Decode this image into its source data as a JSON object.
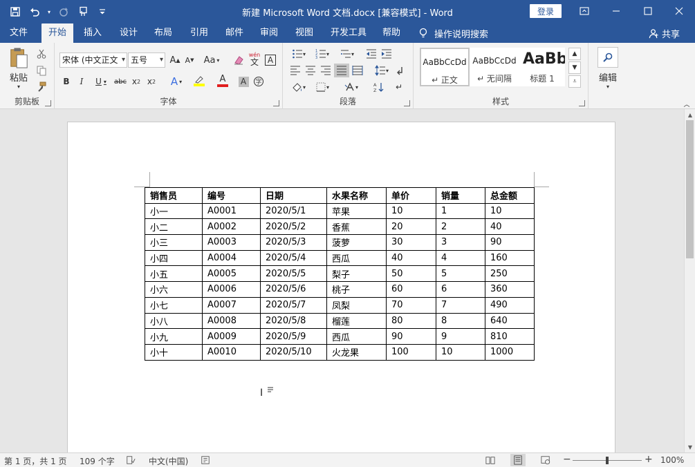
{
  "titlebar": {
    "title": "新建 Microsoft Word 文档.docx [兼容模式]  -  Word",
    "login": "登录"
  },
  "tabs": [
    {
      "label": "文件",
      "name": "tab-file"
    },
    {
      "label": "开始",
      "name": "tab-home"
    },
    {
      "label": "插入",
      "name": "tab-insert"
    },
    {
      "label": "设计",
      "name": "tab-design"
    },
    {
      "label": "布局",
      "name": "tab-layout"
    },
    {
      "label": "引用",
      "name": "tab-references"
    },
    {
      "label": "邮件",
      "name": "tab-mailings"
    },
    {
      "label": "审阅",
      "name": "tab-review"
    },
    {
      "label": "视图",
      "name": "tab-view"
    },
    {
      "label": "开发工具",
      "name": "tab-developer"
    },
    {
      "label": "帮助",
      "name": "tab-help"
    }
  ],
  "tell_me": "操作说明搜索",
  "share": "共享",
  "ribbon": {
    "clipboard": {
      "label": "剪贴板",
      "paste": "粘贴"
    },
    "font": {
      "label": "字体",
      "font_name": "宋体 (中文正文",
      "font_size": "五号",
      "change_case": "Aa",
      "phonetic": "wén",
      "phonetic_char": "文"
    },
    "paragraph": {
      "label": "段落"
    },
    "styles": {
      "label": "样式",
      "items": [
        {
          "sample": "AaBbCcDd",
          "name": "↵ 正文"
        },
        {
          "sample": "AaBbCcDd",
          "name": "↵ 无间隔"
        },
        {
          "sample": "AaBb",
          "name": "标题 1"
        }
      ]
    },
    "editing": {
      "label": "编辑"
    }
  },
  "table": {
    "headers": [
      "销售员",
      "编号",
      "日期",
      "水果名称",
      "单价",
      "销量",
      "总金额"
    ],
    "rows": [
      [
        "小一",
        "A0001",
        "2020/5/1",
        "苹果",
        "10",
        "1",
        "10"
      ],
      [
        "小二",
        "A0002",
        "2020/5/2",
        "香蕉",
        "20",
        "2",
        "40"
      ],
      [
        "小三",
        "A0003",
        "2020/5/3",
        "菠萝",
        "30",
        "3",
        "90"
      ],
      [
        "小四",
        "A0004",
        "2020/5/4",
        "西瓜",
        "40",
        "4",
        "160"
      ],
      [
        "小五",
        "A0005",
        "2020/5/5",
        "梨子",
        "50",
        "5",
        "250"
      ],
      [
        "小六",
        "A0006",
        "2020/5/6",
        "桃子",
        "60",
        "6",
        "360"
      ],
      [
        "小七",
        "A0007",
        "2020/5/7",
        "凤梨",
        "70",
        "7",
        "490"
      ],
      [
        "小八",
        "A0008",
        "2020/5/8",
        "榴莲",
        "80",
        "8",
        "640"
      ],
      [
        "小九",
        "A0009",
        "2020/5/9",
        "西瓜",
        "90",
        "9",
        "810"
      ],
      [
        "小十",
        "A0010",
        "2020/5/10",
        "火龙果",
        "100",
        "10",
        "1000"
      ]
    ]
  },
  "status": {
    "page": "第 1 页，共 1 页",
    "words": "109 个字",
    "language": "中文(中国)",
    "zoom": "100%",
    "zoom_minus": "−",
    "zoom_plus": "+"
  },
  "colors": {
    "brand": "#2b579a",
    "ribbon_bg": "#f3f3f3",
    "font_color_red": "#e11f1f",
    "highlight_yellow": "#ffff00"
  }
}
